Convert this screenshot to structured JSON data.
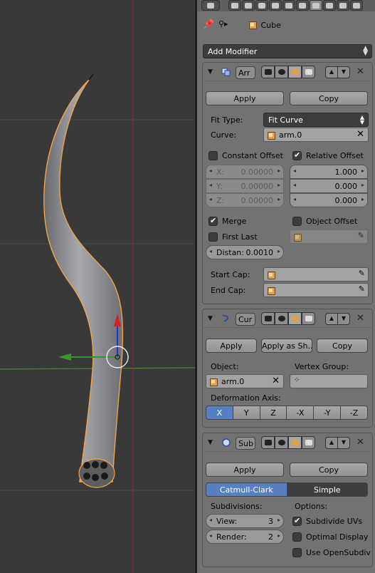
{
  "context": {
    "object_name": "Cube"
  },
  "add_modifier_label": "Add Modifier",
  "array_modifier": {
    "name": "Arr",
    "apply_label": "Apply",
    "copy_label": "Copy",
    "fit_type_label": "Fit Type:",
    "fit_type_value": "Fit Curve",
    "curve_label": "Curve:",
    "curve_value": "arm.0",
    "constant_offset_label": "Constant Offset",
    "constant_offset_checked": false,
    "relative_offset_label": "Relative Offset",
    "relative_offset_checked": true,
    "constant": [
      {
        "axis": "X:",
        "value": "0.00000"
      },
      {
        "axis": "Y:",
        "value": "0.00000"
      },
      {
        "axis": "Z:",
        "value": "0.00000"
      }
    ],
    "relative": [
      "1.000",
      "0.000",
      "0.000"
    ],
    "merge_label": "Merge",
    "merge_checked": true,
    "object_offset_label": "Object Offset",
    "object_offset_checked": false,
    "first_last_label": "First Last",
    "first_last_checked": false,
    "distance_label": "Distan:",
    "distance_value": "0.0010",
    "start_cap_label": "Start Cap:",
    "end_cap_label": "End Cap:"
  },
  "curve_modifier": {
    "name": "Cur",
    "apply_label": "Apply",
    "apply_shape_label": "Apply as Sh...",
    "copy_label": "Copy",
    "object_label": "Object:",
    "object_value": "arm.0",
    "vertex_group_label": "Vertex Group:",
    "deformation_axis_label": "Deformation Axis:",
    "axes": [
      "X",
      "Y",
      "Z",
      "-X",
      "-Y",
      "-Z"
    ],
    "active_axis": "X"
  },
  "subsurf_modifier": {
    "name": "Sub",
    "apply_label": "Apply",
    "copy_label": "Copy",
    "algorithms": [
      "Catmull-Clark",
      "Simple"
    ],
    "active_algorithm": "Catmull-Clark",
    "subdivisions_label": "Subdivisions:",
    "view_label": "View:",
    "view_value": "3",
    "render_label": "Render:",
    "render_value": "2",
    "options_label": "Options:",
    "subdivide_uvs_label": "Subdivide UVs",
    "subdivide_uvs_checked": true,
    "optimal_display_label": "Optimal Display",
    "optimal_display_checked": false,
    "use_opensubdiv_label": "Use OpenSubdiv",
    "use_opensubdiv_checked": false
  },
  "colors": {
    "viewport_bg": "#393939",
    "panel_bg": "#727272",
    "active_blue": "#5680c2",
    "x_axis_line": "#c0342f",
    "y_axis_line": "#4d8a3a",
    "selection_orange": "#f2a447"
  }
}
